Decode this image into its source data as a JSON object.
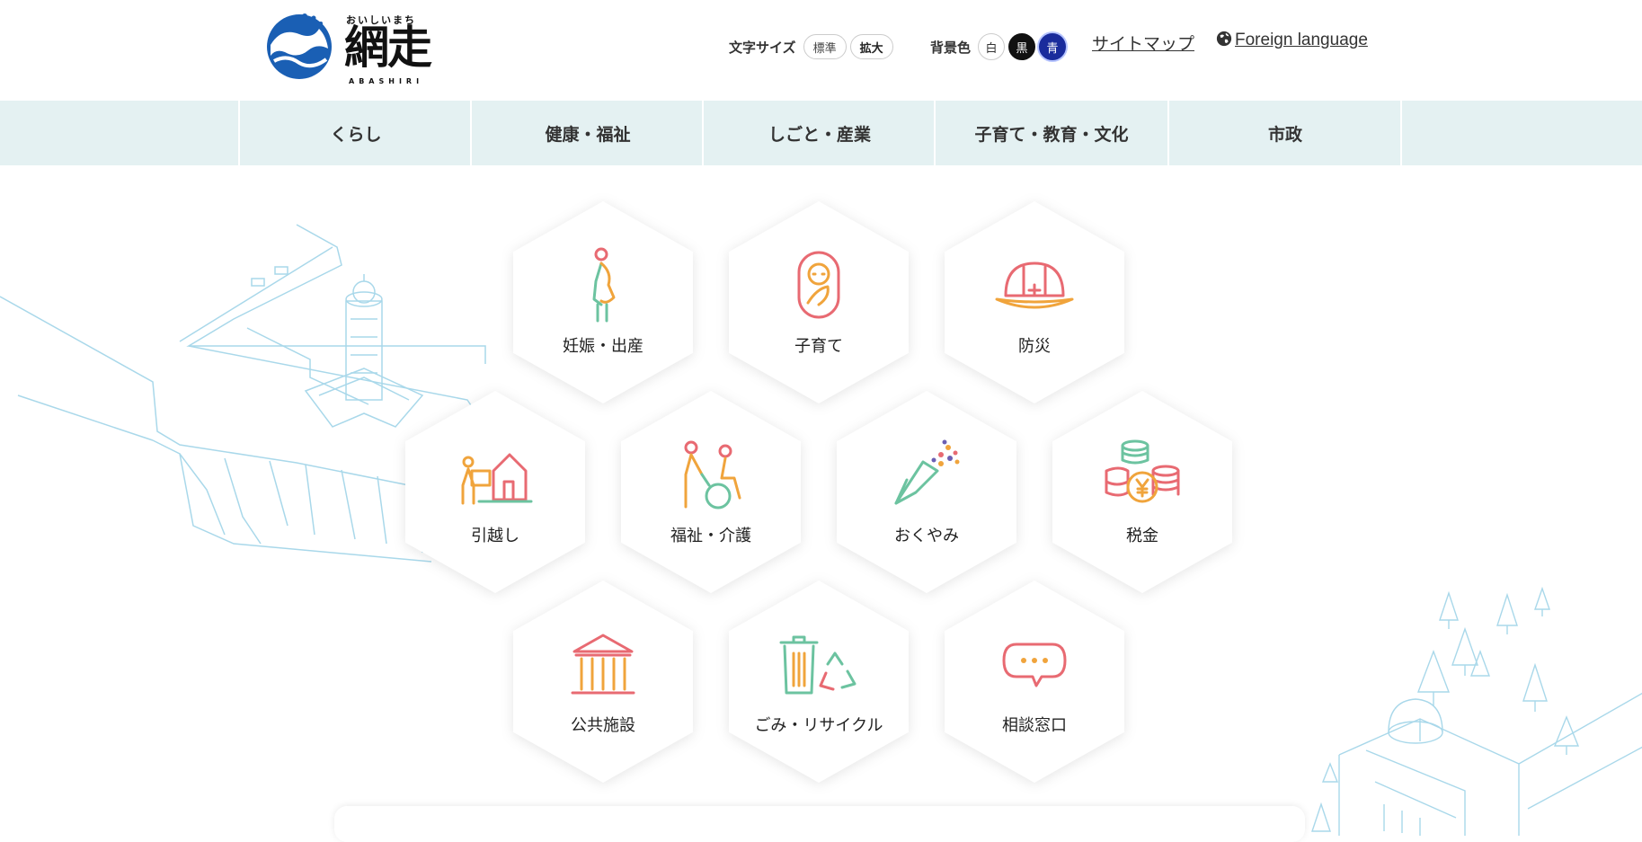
{
  "logo": {
    "kana": "おいしいまち",
    "main": "網走",
    "roman": "ABASHIRI"
  },
  "utility": {
    "font_size_label": "文字サイズ",
    "font_size_options": [
      "標準",
      "拡大"
    ],
    "bg_color_label": "背景色",
    "bg_color_options": [
      "白",
      "黒",
      "青"
    ],
    "sitemap": "サイトマップ",
    "foreign_language": "Foreign language"
  },
  "nav": {
    "items": [
      "くらし",
      "健康・福祉",
      "しごと・産業",
      "子育て・教育・文化",
      "市政"
    ]
  },
  "tiles": [
    {
      "label": "妊娠・出産",
      "icon": "pregnancy-icon"
    },
    {
      "label": "子育て",
      "icon": "baby-icon"
    },
    {
      "label": "防災",
      "icon": "helmet-icon"
    },
    {
      "label": "引越し",
      "icon": "moving-icon"
    },
    {
      "label": "福祉・介護",
      "icon": "wheelchair-care-icon"
    },
    {
      "label": "おくやみ",
      "icon": "flower-bouquet-icon"
    },
    {
      "label": "税金",
      "icon": "coins-yen-icon"
    },
    {
      "label": "公共施設",
      "icon": "public-building-icon"
    },
    {
      "label": "ごみ・リサイクル",
      "icon": "trash-recycle-icon"
    },
    {
      "label": "相談窓口",
      "icon": "chat-bubble-icon"
    }
  ],
  "colors": {
    "nav_bg": "#e4f1f2",
    "accent_red": "#e86a72",
    "accent_orange": "#f0a43c",
    "accent_green": "#6cc3a0",
    "accent_blue": "#1a5fb4",
    "illustration_line": "#a9d8ea"
  }
}
